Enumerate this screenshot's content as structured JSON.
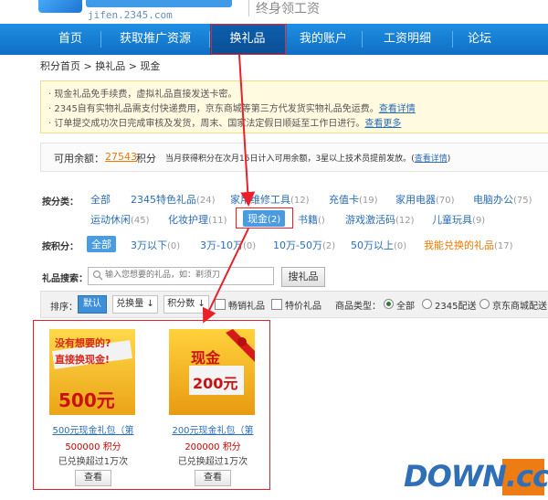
{
  "header": {
    "url": "jifen.2345.com",
    "slogan": "终身领工资"
  },
  "nav": [
    "首页",
    "获取推广资源",
    "换礼品",
    "我的账户",
    "工资明细",
    "论坛"
  ],
  "breadcrumb": "积分首页 > 换礼品 > 现金",
  "notice": {
    "line1": "· 现金礼品免手续费，虚拟礼品直接发送卡密。",
    "line2": "· 2345自有实物礼品需支付快递费用，京东商城等第三方代发货实物礼品免运费。",
    "line2_link": "查看详情",
    "line3": "· 订单提交成功次日完成审核及发货，周末、国家法定假日顺延至工作日进行。",
    "line3_link": "查看更多"
  },
  "balance": {
    "label": "可用余额：",
    "value": "27543",
    "unit": "积分",
    "note": "当月获得积分在次月15日计入可用余额，3星以上技术员提前发放。",
    "link": "查看详情"
  },
  "category_filter": {
    "label": "按分类：",
    "row1": [
      {
        "name": "全部",
        "count": ""
      },
      {
        "name": "2345特色礼品",
        "count": "(24)"
      },
      {
        "name": "家用维修工具",
        "count": "(12)"
      },
      {
        "name": "充值卡",
        "count": "(19)"
      },
      {
        "name": "家用电器",
        "count": "(70)"
      },
      {
        "name": "电脑办公",
        "count": "(75)"
      }
    ],
    "row2": [
      {
        "name": "运动休闲",
        "count": "(45)"
      },
      {
        "name": "化妆护理",
        "count": "(11)"
      },
      {
        "name": "现金",
        "count": "(2)"
      },
      {
        "name": "书籍",
        "count": "()"
      },
      {
        "name": "游戏激活码",
        "count": "(12)"
      },
      {
        "name": "儿童玩具",
        "count": "(9)"
      }
    ]
  },
  "points_filter": {
    "label": "按积分：",
    "items": [
      {
        "name": "全部",
        "count": ""
      },
      {
        "name": "3万以下",
        "count": "(0)"
      },
      {
        "name": "3万-10万",
        "count": "(0)"
      },
      {
        "name": "10万-50万",
        "count": "(2)"
      },
      {
        "name": "50万以上",
        "count": "(0)"
      },
      {
        "name": "我能兑换的礼品",
        "count": "(17)"
      }
    ]
  },
  "search": {
    "label": "礼品搜索：",
    "placeholder": "输入您想要的礼品，如：剃须刀",
    "button": "搜礼品"
  },
  "sortbar": {
    "label": "排序：",
    "default": "默认",
    "by_count": "兑换量 ↓",
    "by_points": "积分数 ↓",
    "hot": "畅销礼品",
    "special": "特价礼品",
    "type_label": "商品类型：",
    "type_all": "全部",
    "type_2345": "2345配送",
    "type_jd": "京东商城配送"
  },
  "products": [
    {
      "name": "500元现金礼包（第",
      "price": "500000",
      "unit": "积分",
      "sold": "已兑换超过1万次",
      "button": "查看",
      "img_line1": "没有想要的?",
      "img_line2": "直接换现金!",
      "img_amount": "500元"
    },
    {
      "name": "200元现金礼包（第",
      "price": "200000",
      "unit": "积分",
      "sold": "已兑换超过1万次",
      "button": "查看",
      "img_line1": "现金",
      "img_amount": "200元"
    }
  ],
  "watermark": "DOWN.cc",
  "colors": {
    "nav": "#1780d6",
    "accent_red": "#e8202a",
    "link": "#2b6db5",
    "price": "#d00000"
  }
}
